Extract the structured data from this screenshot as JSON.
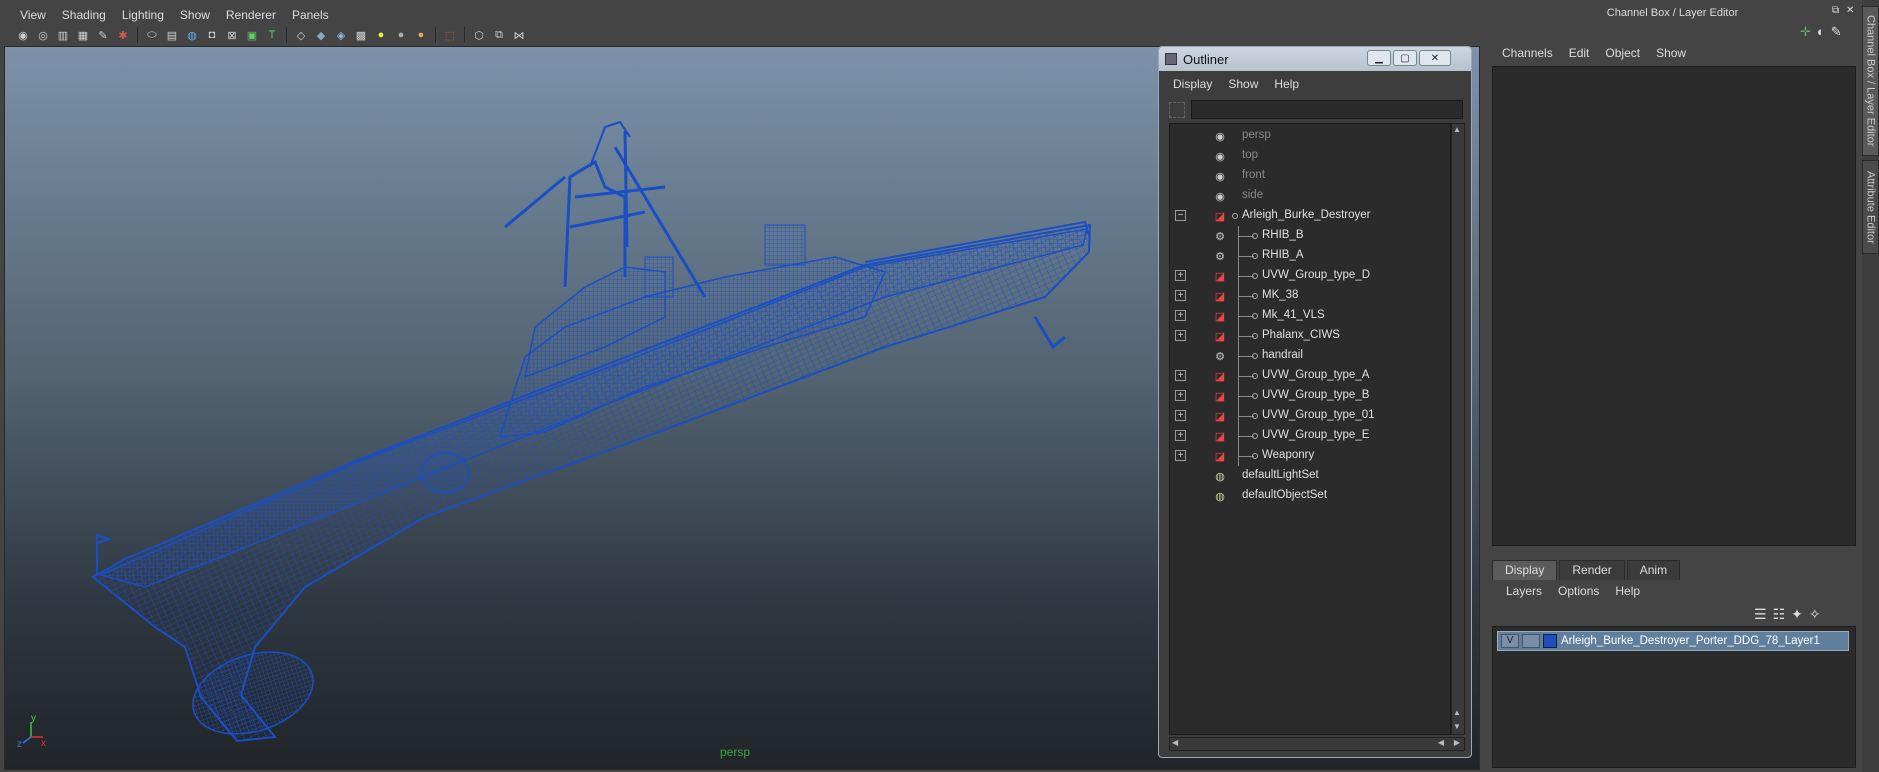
{
  "viewport": {
    "menu": [
      "View",
      "Shading",
      "Lighting",
      "Show",
      "Renderer",
      "Panels"
    ],
    "camera_label": "persp",
    "axis_labels": {
      "y": "y",
      "x": "x",
      "z": "z"
    },
    "toolbar_icons": [
      "camera-icon",
      "camera-attrs-icon",
      "bookmark-icon",
      "image-plane-icon",
      "grid-icon",
      "xray-icon",
      "wireframe-icon",
      "smooth-shade-icon",
      "default-light-icon",
      "shadows-icon",
      "textured-icon",
      "hud-icon",
      "isolate-icon",
      "ao-icon",
      "cube-icon",
      "cube-solid-icon",
      "cube-tex-icon",
      "checker-icon",
      "sphere-icon",
      "sphere-gray-icon",
      "sphere-gold-icon",
      "select-icon",
      "snap-icon",
      "panel-icon",
      "graph-icon"
    ]
  },
  "outliner": {
    "title": "Outliner",
    "menu": [
      "Display",
      "Show",
      "Help"
    ],
    "items": [
      {
        "label": "persp",
        "dim": true,
        "icon": "camera-icon",
        "level": 0,
        "expander": ""
      },
      {
        "label": "top",
        "dim": true,
        "icon": "camera-icon",
        "level": 0,
        "expander": ""
      },
      {
        "label": "front",
        "dim": true,
        "icon": "camera-icon",
        "level": 0,
        "expander": ""
      },
      {
        "label": "side",
        "dim": true,
        "icon": "camera-icon",
        "level": 0,
        "expander": ""
      },
      {
        "label": "Arleigh_Burke_Destroyer",
        "dim": false,
        "icon": "transform-icon",
        "level": 0,
        "expander": "−"
      },
      {
        "label": "RHIB_B",
        "dim": false,
        "icon": "group-icon",
        "level": 1,
        "expander": ""
      },
      {
        "label": "RHIB_A",
        "dim": false,
        "icon": "group-icon",
        "level": 1,
        "expander": ""
      },
      {
        "label": "UVW_Group_type_D",
        "dim": false,
        "icon": "transform-icon",
        "level": 1,
        "expander": "+"
      },
      {
        "label": "MK_38",
        "dim": false,
        "icon": "transform-icon",
        "level": 1,
        "expander": "+"
      },
      {
        "label": "Mk_41_VLS",
        "dim": false,
        "icon": "transform-icon",
        "level": 1,
        "expander": "+"
      },
      {
        "label": "Phalanx_CIWS",
        "dim": false,
        "icon": "transform-icon",
        "level": 1,
        "expander": "+"
      },
      {
        "label": "handrail",
        "dim": false,
        "icon": "group-icon",
        "level": 1,
        "expander": ""
      },
      {
        "label": "UVW_Group_type_A",
        "dim": false,
        "icon": "transform-icon",
        "level": 1,
        "expander": "+"
      },
      {
        "label": "UVW_Group_type_B",
        "dim": false,
        "icon": "transform-icon",
        "level": 1,
        "expander": "+"
      },
      {
        "label": "UVW_Group_type_01",
        "dim": false,
        "icon": "transform-icon",
        "level": 1,
        "expander": "+"
      },
      {
        "label": "UVW_Group_type_E",
        "dim": false,
        "icon": "transform-icon",
        "level": 1,
        "expander": "+"
      },
      {
        "label": "Weaponry",
        "dim": false,
        "icon": "transform-icon",
        "level": 1,
        "expander": "+"
      },
      {
        "label": "defaultLightSet",
        "dim": false,
        "icon": "set-icon",
        "level": 0,
        "expander": ""
      },
      {
        "label": "defaultObjectSet",
        "dim": false,
        "icon": "set-icon",
        "level": 0,
        "expander": ""
      }
    ]
  },
  "channel_box": {
    "title": "Channel Box / Layer Editor",
    "menu": [
      "Channels",
      "Edit",
      "Object",
      "Show"
    ],
    "tabs": [
      {
        "label": "Display",
        "active": true
      },
      {
        "label": "Render",
        "active": false
      },
      {
        "label": "Anim",
        "active": false
      }
    ],
    "layer_menu": [
      "Layers",
      "Options",
      "Help"
    ],
    "layer": {
      "visible": "V",
      "name": "Arleigh_Burke_Destroyer_Porter_DDG_78_Layer1",
      "color": "#1f4fbf"
    }
  },
  "side_tabs": [
    "Channel Box / Layer Editor",
    "Attribute Editor"
  ],
  "colors": {
    "wireframe": "#1a4ec4",
    "viewport_top": "#7b92aa",
    "viewport_bottom": "#212529"
  }
}
